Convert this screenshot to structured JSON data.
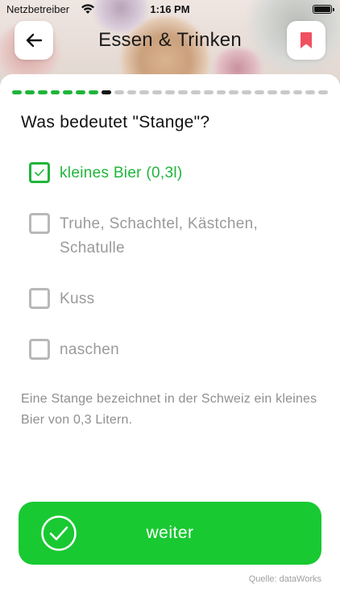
{
  "status_bar": {
    "carrier": "Netzbetreiber",
    "time": "1:16 PM"
  },
  "header": {
    "title": "Essen & Trinken",
    "back_icon": "arrow-left-icon",
    "bookmark_icon": "bookmark-icon",
    "bookmark_color": "#f05060"
  },
  "progress": {
    "done_color": "#1fb53a",
    "current_color": "#111111",
    "pending_color": "#c9c9c9",
    "completed": 7,
    "current": 8,
    "total": 25
  },
  "quiz": {
    "question": "Was bedeutet \"Stange\"?",
    "options": [
      {
        "label": "kleines Bier (0,3l)",
        "checked": true,
        "state": "correct"
      },
      {
        "label": "Truhe, Schachtel, Kästchen, Schatulle",
        "checked": false,
        "state": "neutral"
      },
      {
        "label": "Kuss",
        "checked": false,
        "state": "neutral"
      },
      {
        "label": "naschen",
        "checked": false,
        "state": "neutral"
      }
    ],
    "explanation": "Eine Stange bezeichnet in der Schweiz ein kleines Bier von 0,3 Litern."
  },
  "footer": {
    "continue_label": "weiter",
    "continue_icon": "check-circle-icon",
    "accent": "#19c932",
    "source": "Quelle: dataWorks"
  }
}
